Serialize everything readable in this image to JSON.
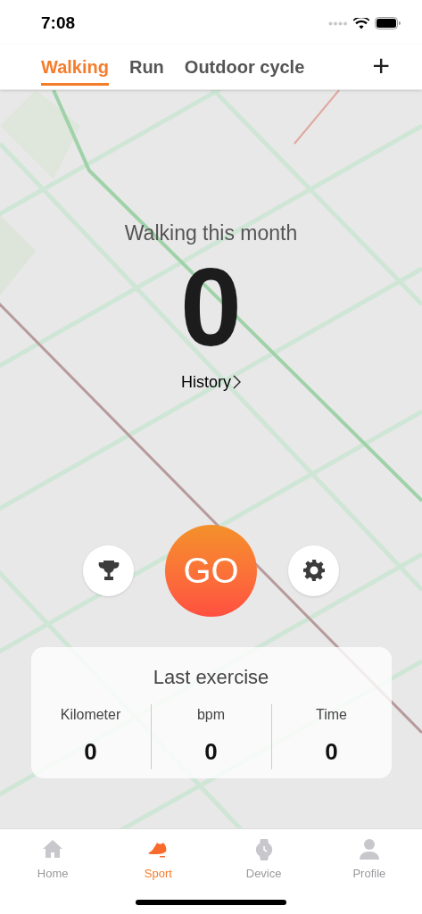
{
  "status_bar": {
    "time": "7:08"
  },
  "tabs": [
    {
      "label": "Walking",
      "selected": true
    },
    {
      "label": "Run",
      "selected": false
    },
    {
      "label": "Outdoor cycle",
      "selected": false
    }
  ],
  "add_button": {
    "label": "+"
  },
  "summary": {
    "title": "Walking this month",
    "value": "0",
    "link": "History"
  },
  "go_button": {
    "label": "GO"
  },
  "last_exercise": {
    "title": "Last exercise",
    "stats": [
      {
        "label": "Kilometer",
        "value": "0"
      },
      {
        "label": "bpm",
        "value": "0"
      },
      {
        "label": "Time",
        "value": "0"
      }
    ]
  },
  "tab_bar": [
    {
      "label": "Home",
      "selected": false
    },
    {
      "label": "Sport",
      "selected": true
    },
    {
      "label": "Device",
      "selected": false
    },
    {
      "label": "Profile",
      "selected": false
    }
  ]
}
